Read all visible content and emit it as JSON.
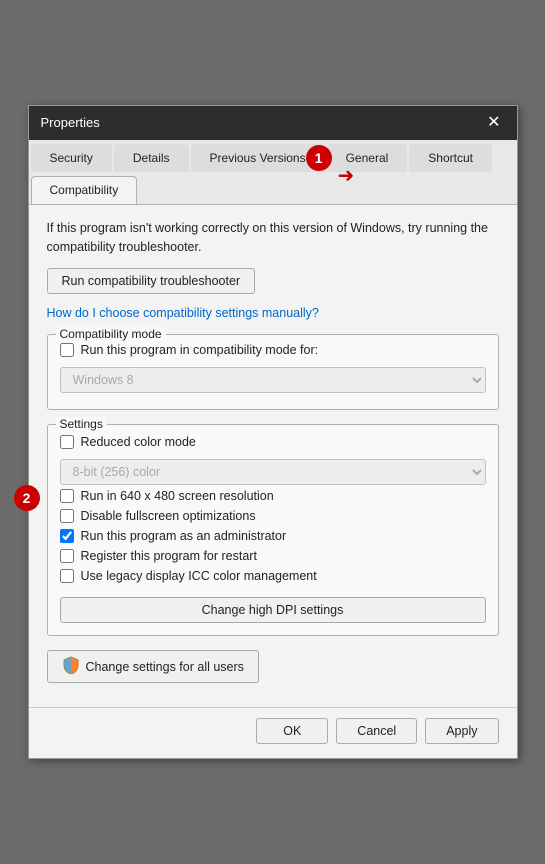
{
  "titlebar": {
    "title": "Properties",
    "close_label": "✕"
  },
  "tabs": [
    {
      "id": "security",
      "label": "Security",
      "active": false
    },
    {
      "id": "details",
      "label": "Details",
      "active": false
    },
    {
      "id": "previous-versions",
      "label": "Previous Versions",
      "active": false
    },
    {
      "id": "general",
      "label": "General",
      "active": false
    },
    {
      "id": "shortcut",
      "label": "Shortcut",
      "active": false
    },
    {
      "id": "compatibility",
      "label": "Compatibility",
      "active": true
    }
  ],
  "content": {
    "description": "If this program isn't working correctly on this version of Windows, try running the compatibility troubleshooter.",
    "troubleshooter_btn": "Run compatibility troubleshooter",
    "help_link": "How do I choose compatibility settings manually?",
    "compat_mode": {
      "group_label": "Compatibility mode",
      "checkbox_label": "Run this program in compatibility mode for:",
      "checkbox_checked": false,
      "dropdown_value": "Windows 8",
      "dropdown_disabled": true
    },
    "settings": {
      "group_label": "Settings",
      "items": [
        {
          "label": "Reduced color mode",
          "checked": false
        },
        {
          "label": "Run in 640 x 480 screen resolution",
          "checked": false
        },
        {
          "label": "Disable fullscreen optimizations",
          "checked": false
        },
        {
          "label": "Run this program as an administrator",
          "checked": true
        },
        {
          "label": "Register this program for restart",
          "checked": false
        },
        {
          "label": "Use legacy display ICC color management",
          "checked": false
        }
      ],
      "color_dropdown": "8-bit (256) color",
      "color_dropdown_disabled": true,
      "high_dpi_btn": "Change high DPI settings"
    },
    "change_all_btn": "Change settings for all users"
  },
  "footer": {
    "ok": "OK",
    "cancel": "Cancel",
    "apply": "Apply"
  },
  "annotations": {
    "bubble1": "1",
    "bubble2": "2"
  }
}
